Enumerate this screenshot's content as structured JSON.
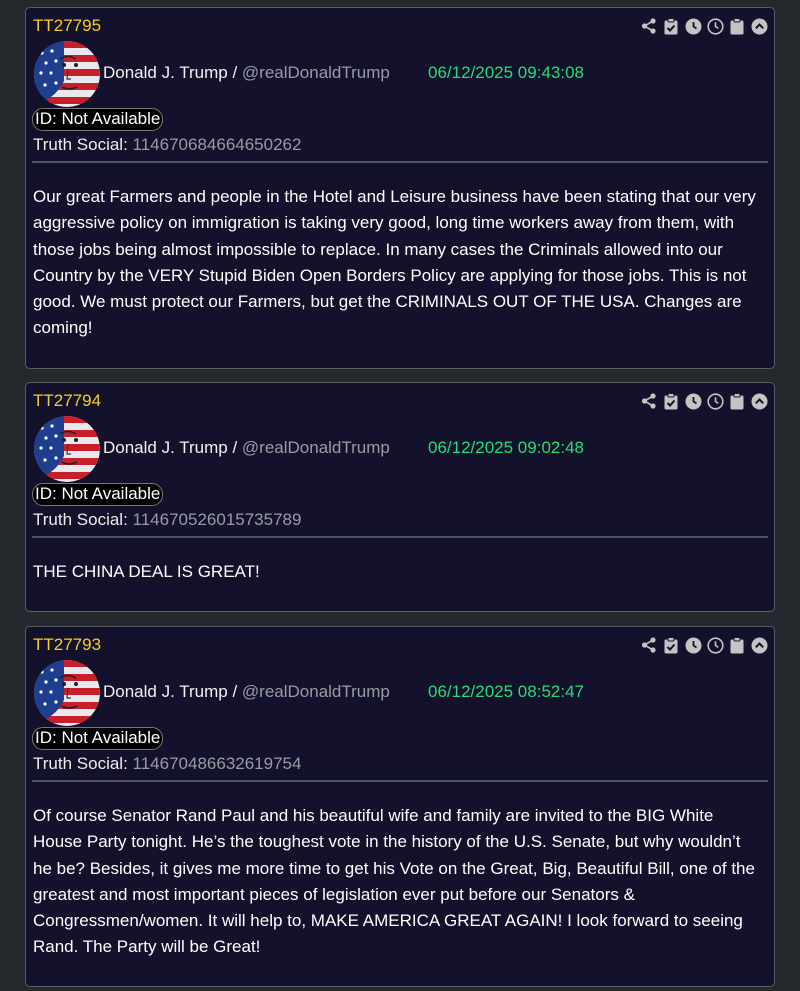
{
  "posts": [
    {
      "id": "TT27795",
      "author_name": "Donald J. Trump",
      "author_sep": " / ",
      "author_handle": "@realDonaldTrump",
      "timestamp": "06/12/2025 09:43:08",
      "id_badge": "ID: Not Available",
      "truth_label": "Truth Social: ",
      "truth_id": "114670684664650262",
      "text": "Our great Farmers and people in the Hotel and Leisure business have been stating that our very aggressive policy on immigration is taking very good, long time workers away from them, with those jobs being almost impossible to replace. In many cases the Criminals allowed into our Country by the VERY Stupid Biden Open Borders Policy are applying for those jobs. This is not good. We must protect our Farmers, but get the CRIMINALS OUT OF THE USA. Changes are coming!"
    },
    {
      "id": "TT27794",
      "author_name": "Donald J. Trump",
      "author_sep": " / ",
      "author_handle": "@realDonaldTrump",
      "timestamp": "06/12/2025 09:02:48",
      "id_badge": "ID: Not Available",
      "truth_label": "Truth Social: ",
      "truth_id": "114670526015735789",
      "text": "THE CHINA DEAL IS GREAT!"
    },
    {
      "id": "TT27793",
      "author_name": "Donald J. Trump",
      "author_sep": " / ",
      "author_handle": "@realDonaldTrump",
      "timestamp": "06/12/2025 08:52:47",
      "id_badge": "ID: Not Available",
      "truth_label": "Truth Social: ",
      "truth_id": "114670486632619754",
      "text": "Of course Senator Rand Paul and his beautiful wife and family are invited to the BIG White House Party tonight. He’s the toughest vote in the history of the U.S. Senate, but why wouldn’t he be? Besides, it gives me more time to get his Vote on the Great, Big, Beautiful Bill, one of the greatest and most important pieces of legislation ever put before our Senators & Congressmen/women. It will help to, MAKE AMERICA GREAT AGAIN! I look forward to seeing Rand. The Party will be Great!"
    }
  ],
  "icons": [
    "share-icon",
    "clipboard-check-icon",
    "clock-filled-icon",
    "clock-outline-icon",
    "clipboard-icon",
    "chevron-up-circle-icon"
  ],
  "colors": {
    "post_id": "#f5cf27",
    "timestamp": "#22de74",
    "card_bg": "#13112b",
    "page_bg": "#25282d"
  }
}
